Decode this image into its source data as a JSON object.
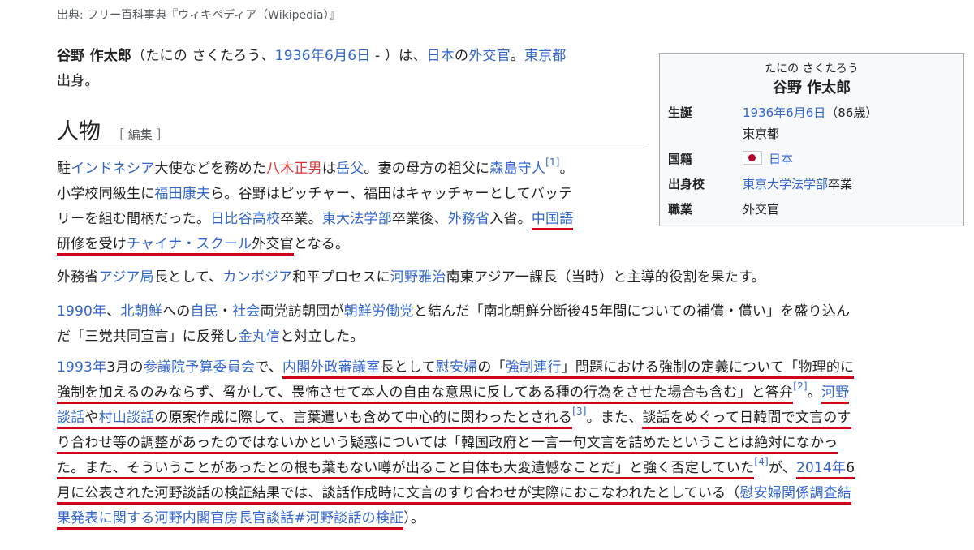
{
  "source_line": "出典: フリー百科事典『ウィキペディア（Wikipedia）』",
  "lead": {
    "name": "谷野 作太郎",
    "t1": "（たにの さくたろう、",
    "birth_link": "1936年6月6日",
    "t2": " - ）は、",
    "nation_link": "日本",
    "t3": "の",
    "job_link": "外交官",
    "t4": "。",
    "place_link": "東京都",
    "t5": "出身。"
  },
  "section": {
    "title": "人物",
    "edit": "［ 編集 ］"
  },
  "p1": {
    "a": "駐",
    "l1": "インドネシア",
    "b": "大使などを務めた",
    "r1": "八木正男",
    "c": "は",
    "l2": "岳父",
    "d": "。妻の母方の祖父に",
    "l3": "森島守人",
    "ref1": "[1]",
    "e": "。",
    "f": "小学校同級生に",
    "l4": "福田康夫",
    "g": "ら。谷野はピッチャー、福田はキャッチャーとしてバッテ",
    "h": "リーを組む間柄だった。",
    "l5": "日比谷高校",
    "i": "卒業。",
    "l6": "東大法学部",
    "j": "卒業後、",
    "l7": "外務省",
    "k": "入省。",
    "l8": "中国語",
    "m": "研修を受け",
    "l9": "チャイナ・スクール",
    "n": "外交官",
    "o": "となる。"
  },
  "p2": {
    "a": "外務省",
    "l1": "アジア局",
    "b": "長として、",
    "l2": "カンボジア",
    "c": "和平プロセスに",
    "l3": "河野雅治",
    "d": "南東アジア一課長（当時）と主導的役割を果たす。"
  },
  "p3": {
    "l1": "1990年",
    "a": "、",
    "l2": "北朝鮮",
    "b": "への",
    "l3": "自民",
    "c": "・",
    "l4": "社会",
    "d": "両党訪朝団が",
    "l5": "朝鮮労働党",
    "e": "と結んだ「南北朝鮮分断後45年間についての補償・償い」を盛り込ん",
    "f": "だ「三党共同宣言」に反発し",
    "l6": "金丸信",
    "g": "と対立した。"
  },
  "p4": {
    "l1": "1993年",
    "a": "3月の",
    "l2": "参議院予算委員会",
    "b": "で、",
    "l3": "内閣外政審議室",
    "c": "長として",
    "l4": "慰安婦",
    "d": "の「",
    "l5": "強制連行",
    "e": "」問題における強制の定義について「物理的に",
    "f": "強制を加えるのみならず、脅かして、畏怖させて本人の自由な意思に反してある種の行為をさせた場合も含む」と答弁",
    "ref2": "[2]",
    "g": "。",
    "l6": "河野",
    "l7": "談話",
    "h": "や",
    "l8": "村山談話",
    "i": "の原案作成に際して、言葉遣いも含めて中心的に関わったとされる",
    "ref3": "[3]",
    "j": "。また、",
    "k": "談話をめぐって日韓間で文言のす",
    "m": "り合わせ等の調整があったのではないかという疑惑については「韓国政府と一言一句文言を詰めたということは絶対になかっ",
    "n": "た。また、そういうことがあったとの根も葉もない噂が出ること自体も大変遺憾なことだ」と強く否定していた",
    "ref4": "[4]",
    "o": "が、",
    "l9": "2014年",
    "p": "6",
    "q": "月に公表された河野談話の検証結果では、談話作成時に文言のすり合わせが実際におこなわれたとしている（",
    "l10": "慰安婦関係調査結",
    "l11": "果発表に関する河野内閣官房長官談話#河野談話の検証",
    "r": "）。"
  },
  "infobox": {
    "kana": "たにの さくたろう",
    "name": "谷野 作太郎",
    "rows": [
      {
        "key": "生誕",
        "link": "1936年6月6日",
        "text": "（86歳）",
        "line2": "東京都"
      },
      {
        "key": "国籍",
        "link": "日本",
        "flag": "japan-flag"
      },
      {
        "key": "出身校",
        "link": "東京大学法学部",
        "text": "卒業"
      },
      {
        "key": "職業",
        "text": "外交官"
      }
    ]
  },
  "colors": {
    "link": "#3366cc",
    "redlink": "#dd3333",
    "underline": "#d0021b",
    "text": "#202122"
  }
}
